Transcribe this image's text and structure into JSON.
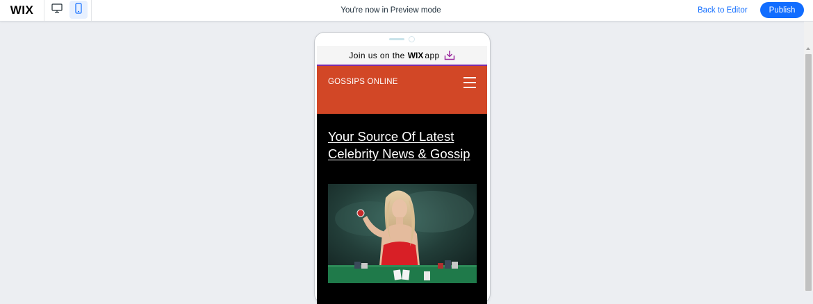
{
  "topbar": {
    "logo": "WIX",
    "preview_text": "You're now in Preview mode",
    "back_to_editor": "Back to Editor",
    "publish": "Publish",
    "icons": [
      "desktop-icon",
      "mobile-icon"
    ],
    "accent_color": "#116dff"
  },
  "phone": {
    "app_banner": {
      "prefix": "Join us on the",
      "brand": "WIX",
      "suffix": "app",
      "icon": "download-icon",
      "accent_color": "#7b2aa8"
    },
    "site": {
      "name": "GOSSIPS ONLINE",
      "header_color": "#d24726",
      "menu_icon": "hamburger-menu-icon",
      "headline_line1": "Your Source Of Latest",
      "headline_line2": "Celebrity News & Gossip",
      "image": "woman-at-poker-table-photo"
    }
  }
}
